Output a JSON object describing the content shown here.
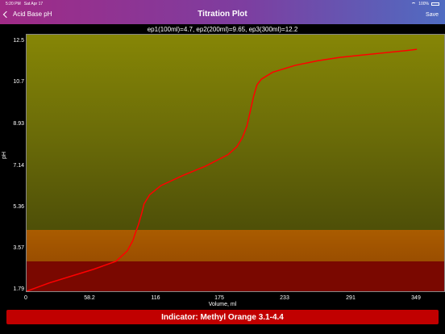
{
  "status": {
    "time": "5:20 PM",
    "date": "Sat Apr 17",
    "wifi": "wifi-icon",
    "battery_text": "100%"
  },
  "nav": {
    "back_label": "Acid Base pH",
    "title": "Titration Plot",
    "save_label": "Save"
  },
  "plot": {
    "header_text": "ep1(100ml)=4.7, ep2(200ml)=9.65, ep3(300ml)=12.2",
    "colors": {
      "upper": "#868606",
      "orange_band": "#aa5c00",
      "red_band": "#7a0800",
      "curve": "#ff0000"
    }
  },
  "chart_data": {
    "type": "line",
    "title": "",
    "xlabel": "Volume,  ml",
    "ylabel": "pH",
    "xlim": [
      0,
      349
    ],
    "ylim": [
      1.79,
      12.5
    ],
    "x_ticks": [
      "0",
      "58.2",
      "116",
      "175",
      "233",
      "291",
      "349"
    ],
    "y_ticks": [
      "12.5",
      "10.7",
      "8.93",
      "7.14",
      "5.36",
      "3.57",
      "1.79"
    ],
    "series": [
      {
        "x": [
          0,
          20,
          40,
          60,
          80,
          90,
          95,
          97,
          100,
          103,
          105,
          110,
          120,
          140,
          160,
          180,
          188,
          193,
          197,
          200,
          203,
          206,
          210,
          220,
          240,
          260,
          280,
          300,
          320,
          340,
          349
        ],
        "y": [
          1.79,
          2.15,
          2.45,
          2.75,
          3.1,
          3.55,
          4.0,
          4.3,
          4.7,
          5.2,
          5.6,
          6.0,
          6.4,
          6.85,
          7.25,
          7.75,
          8.1,
          8.5,
          9.0,
          9.65,
          10.3,
          10.8,
          11.05,
          11.35,
          11.65,
          11.85,
          12.0,
          12.1,
          12.2,
          12.3,
          12.35
        ]
      }
    ]
  },
  "indicator": {
    "label": "Indicator: Methyl Orange 3.1-4.4"
  }
}
